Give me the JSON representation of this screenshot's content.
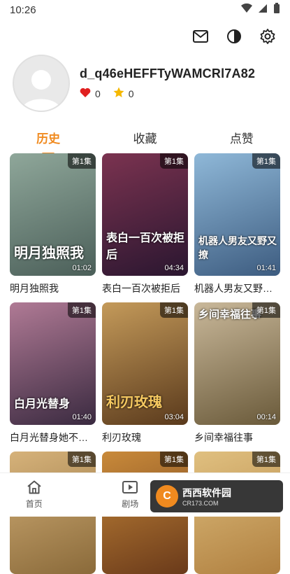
{
  "status_bar": {
    "time": "10:26"
  },
  "profile": {
    "username": "d_q46eHEFFTyWAMCRl7A82",
    "likes": "0",
    "favorites": "0"
  },
  "tabs": [
    {
      "label": "历史",
      "active": true
    },
    {
      "label": "收藏",
      "active": false
    },
    {
      "label": "点赞",
      "active": false
    }
  ],
  "items": [
    {
      "title": "明月独照我",
      "episode": "第1集",
      "duration": "01:02",
      "poster_text": "明月独照我",
      "colors": [
        "#8fa79a",
        "#4b5f59"
      ]
    },
    {
      "title": "表白一百次被拒后",
      "episode": "第1集",
      "duration": "04:34",
      "poster_text": "表白一百次被拒后",
      "colors": [
        "#7b3350",
        "#2a1630"
      ]
    },
    {
      "title": "机器人男友又野又撩",
      "episode": "第1集",
      "duration": "01:41",
      "poster_text": "机器人男友又野又撩",
      "colors": [
        "#8fb8d8",
        "#3d5c80"
      ]
    },
    {
      "title": "白月光替身她不干了",
      "episode": "第1集",
      "duration": "01:40",
      "poster_text": "白月光替身",
      "colors": [
        "#b07a95",
        "#3a2a40"
      ]
    },
    {
      "title": "利刃玫瑰",
      "episode": "第1集",
      "duration": "03:04",
      "poster_text": "利刃玫瑰",
      "colors": [
        "#c49a5a",
        "#5a3a1c"
      ]
    },
    {
      "title": "乡间幸福往事",
      "episode": "第1集",
      "duration": "00:14",
      "poster_text": "乡间幸福往事",
      "colors": [
        "#c9b89a",
        "#6a5a3a"
      ]
    },
    {
      "title": "",
      "episode": "第1集",
      "duration": "",
      "poster_text": "",
      "colors": [
        "#d6b27a",
        "#8a6a3a"
      ]
    },
    {
      "title": "",
      "episode": "第1集",
      "duration": "",
      "poster_text": "",
      "colors": [
        "#c98a3a",
        "#6a3a1a"
      ]
    },
    {
      "title": "",
      "episode": "第1集",
      "duration": "",
      "poster_text": "",
      "colors": [
        "#e0c080",
        "#b08040"
      ]
    }
  ],
  "bottom_nav": [
    {
      "label": "首页",
      "icon": "home-icon"
    },
    {
      "label": "剧场",
      "icon": "theater-icon"
    }
  ],
  "watermark": {
    "brand": "西西软件园",
    "sub": "CR173.COM"
  },
  "colors": {
    "accent": "#f08a1f",
    "like": "#e02020",
    "star": "#f5b800"
  }
}
